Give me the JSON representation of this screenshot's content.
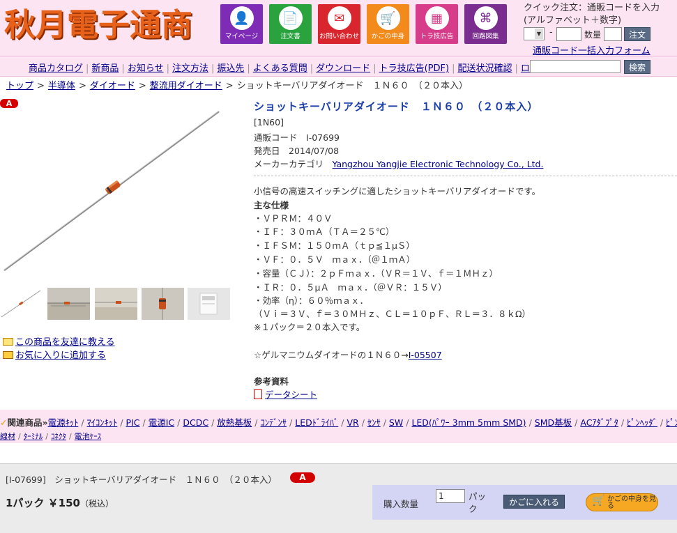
{
  "header": {
    "logo": "秋月電子通商",
    "nav": [
      {
        "label": "マイページ",
        "color": "#7e2bb5",
        "icon": "person-icon",
        "glyph": "👤"
      },
      {
        "label": "注文書",
        "color": "#2aa33f",
        "icon": "order-form-icon",
        "glyph": "📄"
      },
      {
        "label": "お問い合わせ",
        "color": "#d9252d",
        "icon": "mail-icon",
        "glyph": "✉"
      },
      {
        "label": "かごの中身",
        "color": "#f28a1c",
        "icon": "cart-icon",
        "glyph": "🛒"
      },
      {
        "label": "トラ技広告",
        "color": "#d63c8a",
        "icon": "calculator-icon",
        "glyph": "▦"
      },
      {
        "label": "回路図集",
        "color": "#7a2d8e",
        "icon": "circuit-icon",
        "glyph": "⌘"
      }
    ],
    "quick": {
      "line1": "クイック注文：通販コードを入力",
      "line2": "(アルファベット＋数字)",
      "dash": "-",
      "qty_label": "数量",
      "order_button": "注文",
      "form_link": "通販コード一括入力フォーム"
    }
  },
  "menu": {
    "items": [
      "商品カタログ",
      "新商品",
      "お知らせ",
      "注文方法",
      "振込先",
      "よくある質問",
      "ダウンロード",
      "トラ技広告(PDF)",
      "配送状況確認",
      "ログイン"
    ],
    "search_button": "検索"
  },
  "breadcrumb": {
    "links": [
      "トップ",
      "半導体",
      "ダイオード",
      "整流用ダイオード"
    ],
    "current": "ショットキーバリアダイオード　１Ｎ６０　（２０本入）",
    "separator": ">"
  },
  "product": {
    "badge": "A",
    "title": "ショットキーバリアダイオード　１Ｎ６０　（２０本入）",
    "part": "[1N60]",
    "code_label": "通販コード",
    "code": "I-07699",
    "date_label": "発売日",
    "date": "2014/07/08",
    "maker_label": "メーカーカテゴリ",
    "maker": "Yangzhou Yangjie Electronic Technology Co., Ltd.",
    "tell_friend": "この商品を友達に教える",
    "add_fav": "お気に入りに追加する",
    "description": "小信号の高速スイッチングに適したショットキーバリアダイオードです。",
    "specs_heading": "主な仕様",
    "specs": [
      "・ＶＰＲＭ：４０Ｖ",
      "・ＩＦ：３０ｍＡ（ＴＡ＝２５℃）",
      "・ＩＦＳＭ：１５０ｍＡ（ｔｐ≦１μＳ）",
      "・ＶＦ：０．５Ｖ　ｍａｘ．（＠１ｍＡ）",
      "・容量（ＣＪ）：２ｐＦｍａｘ．（ＶＲ＝１Ｖ、ｆ＝１ＭＨｚ）",
      "・ＩＲ：０．５μＡ　ｍａｘ．（＠ＶＲ：１５Ｖ）",
      "・効率（η）：６０％ｍａｘ．",
      "（Ｖｉ＝３Ｖ、ｆ＝３０ＭＨｚ、ＣＬ＝１０ｐＦ、ＲＬ＝３．８ｋΩ）",
      "※１パック＝２０本入です。"
    ],
    "germanium_text": "☆ゲルマニウムダイオードの１Ｎ６０→",
    "germanium_link": "I-05507",
    "ref_heading": "参考資料",
    "datasheet": "データシート"
  },
  "related": {
    "label": "関連商品»",
    "row1": [
      "電源ｷｯﾄ",
      "ﾏｲｺﾝｷｯﾄ",
      "PIC",
      "電源IC",
      "DCDC",
      "放熱基板",
      "ｺﾝﾃﾞﾝｻ",
      "LEDﾄﾞﾗｲﾊﾞ",
      "VR",
      "ｾﾝｻ",
      "SW",
      "LED(ﾊﾟﾜｰ 3mm 5mm SMD)",
      "SMD基板",
      "ACｱﾀﾞﾌﾟﾀ",
      "ﾋﾟﾝﾍｯﾀﾞ",
      "ﾋﾟﾝｿｹｯﾄ"
    ],
    "row2": [
      "線材",
      "ﾀｰﾐﾅﾙ",
      "ｺﾈｸﾀ",
      "電池ｹｰｽ"
    ]
  },
  "cart": {
    "name": "[I-07699]　ショットキーバリアダイオード　１Ｎ６０　（２０本入）",
    "badge": "A",
    "price": "1パック ￥150",
    "tax": "（税込）",
    "qty_label": "購入数量",
    "qty_value": "1",
    "unit": "パック",
    "add_button": "かごに入れる",
    "view_button": "かごの中身を見る"
  }
}
